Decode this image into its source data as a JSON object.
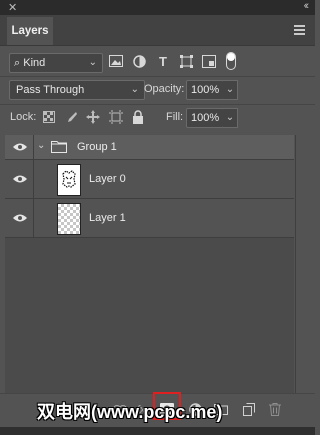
{
  "window": {
    "close_glyph": "✕",
    "collapse_glyph": "‹‹"
  },
  "panel": {
    "tab_label": "Layers",
    "menu_icon": "panel-menu-icon"
  },
  "filter": {
    "kind_label": "Kind",
    "icons": [
      "image-filter-icon",
      "adjustment-filter-icon",
      "type-filter-icon",
      "shape-filter-icon",
      "smart-object-filter-icon",
      "filter-toggle-icon"
    ]
  },
  "blend": {
    "mode": "Pass Through",
    "opacity_label": "Opacity:",
    "opacity_value": "100%"
  },
  "lock": {
    "label": "Lock:",
    "fill_label": "Fill:",
    "fill_value": "100%",
    "icons": [
      "lock-transparent-pixels-icon",
      "lock-image-pixels-icon",
      "lock-position-icon",
      "lock-artboard-icon",
      "lock-all-icon"
    ]
  },
  "layers": [
    {
      "name": "Group 1",
      "type": "group",
      "visible": true,
      "expanded": true
    },
    {
      "name": "Layer 0",
      "type": "pixel",
      "visible": true
    },
    {
      "name": "Layer 1",
      "type": "pixel",
      "visible": true
    }
  ],
  "bottom_icons": [
    "link-layers-icon",
    "fx-icon",
    "add-mask-icon",
    "adjustment-layer-icon",
    "new-group-icon",
    "new-layer-icon",
    "trash-icon"
  ],
  "bottom_labels": {
    "fx": "fx"
  },
  "watermark": "双电网(www.pcpc.me)",
  "colors": {
    "panel_bg": "#535353",
    "highlight": "#e02020"
  }
}
